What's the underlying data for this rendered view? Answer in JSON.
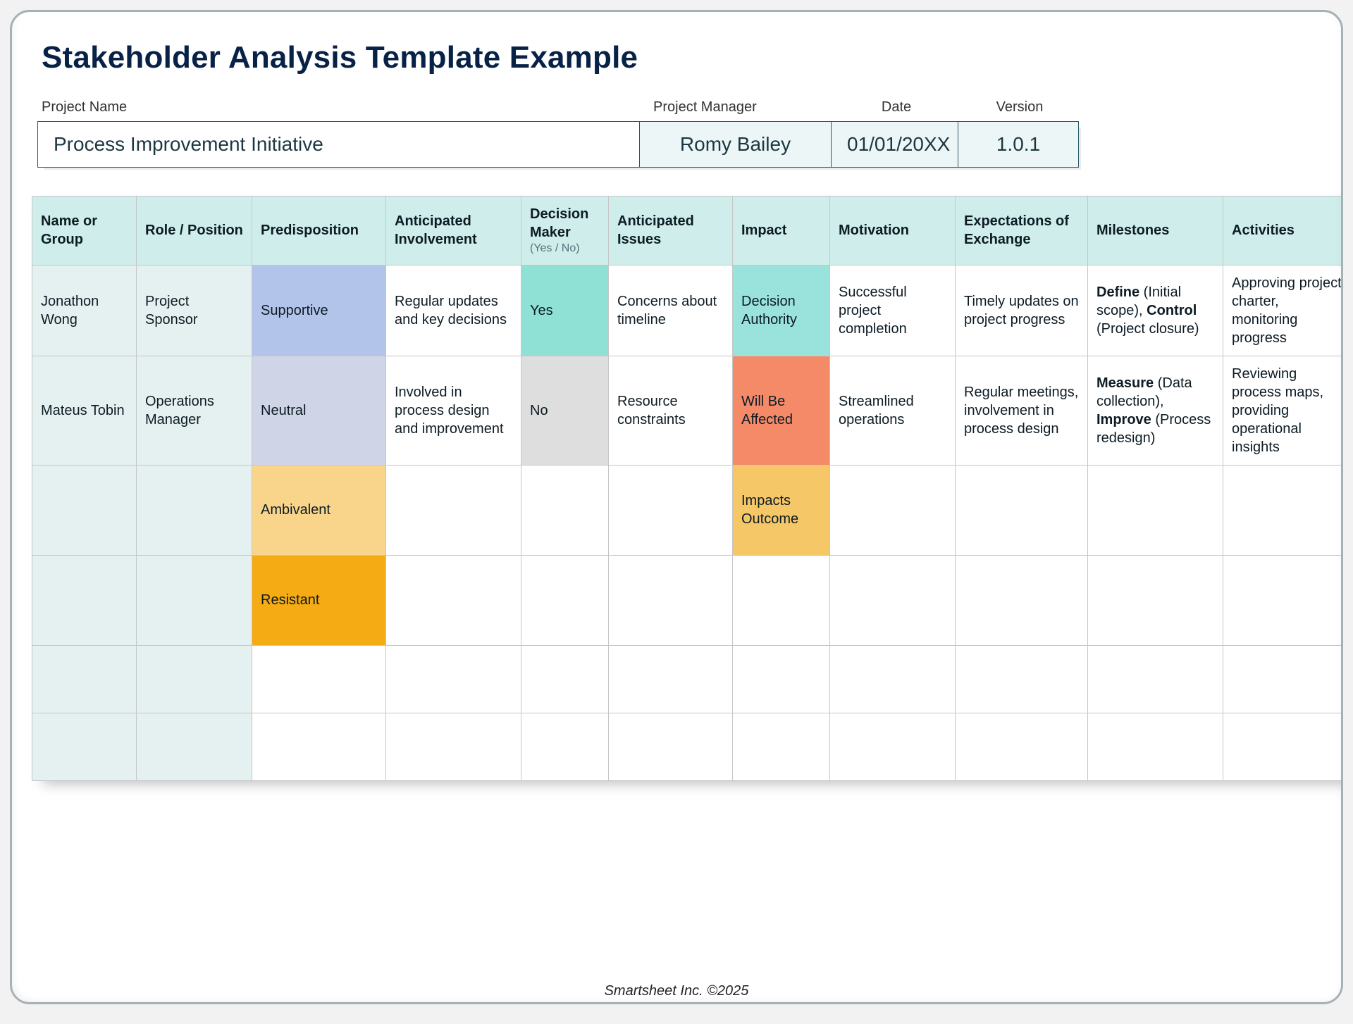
{
  "title": "Stakeholder Analysis Template Example",
  "meta": {
    "labels": {
      "project": "Project Name",
      "manager": "Project Manager",
      "date": "Date",
      "version": "Version"
    },
    "values": {
      "project": "Process Improvement Initiative",
      "manager": "Romy Bailey",
      "date": "01/01/20XX",
      "version": "1.0.1"
    }
  },
  "columns": {
    "name": "Name or Group",
    "role": "Role / Position",
    "pred": "Predisposition",
    "involvement": "Anticipated Involvement",
    "dm": "Decision Maker",
    "dm_sub": "(Yes / No)",
    "issues": "Anticipated Issues",
    "impact": "Impact",
    "motivation": "Motivation",
    "expectations": "Expectations of Exchange",
    "milestones": "Milestones",
    "activities": "Activities"
  },
  "rows": [
    {
      "name": "Jonathon Wong",
      "role": "Project Sponsor",
      "pred": "Supportive",
      "pred_class": "pd-supportive",
      "involvement": "Regular updates and key decisions",
      "dm": "Yes",
      "dm_class": "dm-yes",
      "issues": "Concerns about timeline",
      "impact": "Decision Authority",
      "impact_class": "im-authority",
      "motivation": "Successful project completion",
      "expectations": "Timely updates on project progress",
      "milestones_b1": "Define",
      "milestones_t1": " (Initial scope), ",
      "milestones_b2": "Control",
      "milestones_t2": " (Project closure)",
      "activities": "Approving project charter, monitoring progress"
    },
    {
      "name": "Mateus Tobin",
      "role": "Operations Manager",
      "pred": "Neutral",
      "pred_class": "pd-neutral",
      "involvement": "Involved in process design and improvement",
      "dm": "No",
      "dm_class": "dm-no",
      "issues": "Resource constraints",
      "impact": "Will Be Affected",
      "impact_class": "im-affected",
      "motivation": "Streamlined operations",
      "expectations": "Regular meetings, involvement in process design",
      "milestones_b1": "Measure",
      "milestones_t1": " (Data collection), ",
      "milestones_b2": "Improve",
      "milestones_t2": " (Process redesign)",
      "activities": "Reviewing process maps, providing operational insights"
    },
    {
      "pred": "Ambivalent",
      "pred_class": "pd-ambivalent",
      "impact": "Impacts Outcome",
      "impact_class": "im-outcome"
    },
    {
      "pred": "Resistant",
      "pred_class": "pd-resistant"
    },
    {},
    {}
  ],
  "footer": "Smartsheet Inc. ©2025"
}
